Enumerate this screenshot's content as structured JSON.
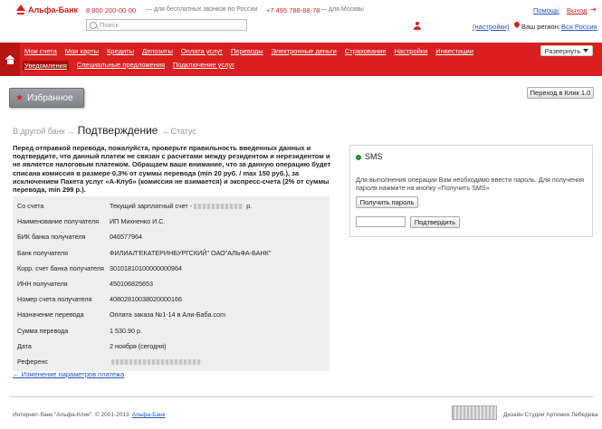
{
  "header": {
    "logo_text": "Альфа-Банк",
    "phone1": "8 800 200-00-00",
    "phone1_note": "— для бесплатных звонков по России",
    "phone2": "+7 495 788-88-78",
    "phone2_note": "— для Москвы",
    "help": "Помощь",
    "logout": "Выход",
    "search_placeholder": "Поиск",
    "settings": "(настройки)",
    "region_label": "Ваш регион:",
    "region_value": "Вся Россия"
  },
  "nav": {
    "row1": [
      "Мои счета",
      "Мои карты",
      "Кредиты",
      "Депозиты",
      "Оплата услуг",
      "Переводы",
      "Электронные деньги",
      "Страхование",
      "Настройки",
      "Инвестиции"
    ],
    "row2": [
      "Уведомления",
      "Специальные предложения",
      "Подключение услуг"
    ],
    "expand": "Развернуть"
  },
  "favorites": "Избранное",
  "go_button": "Переход в Клик 1.0",
  "steps": {
    "prev": "В другой банк",
    "current": "Подтверждение",
    "next": "Статус"
  },
  "warning": "Перед отправкой перевода, пожалуйста, проверьте правильность введенных данных и подтвердите, что данный платеж не связан с расчетами между резидентом и нерезидентом и не является налоговым платежом. Обращаем ваше внимание, что за данную операцию будет списана комиссия в размере 0,3% от суммы перевода (min 20 руб. / max 150 руб.), за исключением Пакета услуг «А-Клуб» (комиссия не взимается) и экспресс-счета (2% от суммы перевода, min 299 р.).",
  "details": [
    {
      "label": "Со счета",
      "value": "Текущий зарплатный счет -",
      "tail": "р.",
      "masked": true
    },
    {
      "label": "Наименование получателя",
      "value": "ИП Михненко И.С."
    },
    {
      "label": "БИК банка получателя",
      "value": "046577964"
    },
    {
      "label": "Банк получателя",
      "value": "ФИЛИАЛ\"ЕКАТЕРИНБУРГСКИЙ\" ОАО\"АЛЬФА-БАНК\""
    },
    {
      "label": "Корр. счет банка получателя",
      "value": "30101810100000000964"
    },
    {
      "label": "ИНН получателя",
      "value": "450106825653"
    },
    {
      "label": "Номер счета получателя",
      "value": "40802810038020000166"
    },
    {
      "label": "Назначение перевода",
      "value": "Оплата заказа №1-14 в Али-Баба.com"
    },
    {
      "label": "Сумма перевода",
      "value": "1 530.90 р."
    },
    {
      "label": "Дата",
      "value": "2 ноября (сегодня)"
    },
    {
      "label": "Референс",
      "value": "",
      "masked": true
    }
  ],
  "back_link": "← Изменение параметров платежа",
  "sms": {
    "title": "SMS",
    "text": "Для выполнения операции Вам необходимо ввести пароль. Для получения пароля нажмите на кнопку «Получить SMS»",
    "get_button": "Получить пароль",
    "confirm_button": "Подтвердить"
  },
  "footer": {
    "copyright": "Интернет-банк \"Альфа-Клик\". © 2001-2013",
    "link": "Альфа-Банк",
    "design": "Дизайн Студии Артемия Лебедева"
  }
}
